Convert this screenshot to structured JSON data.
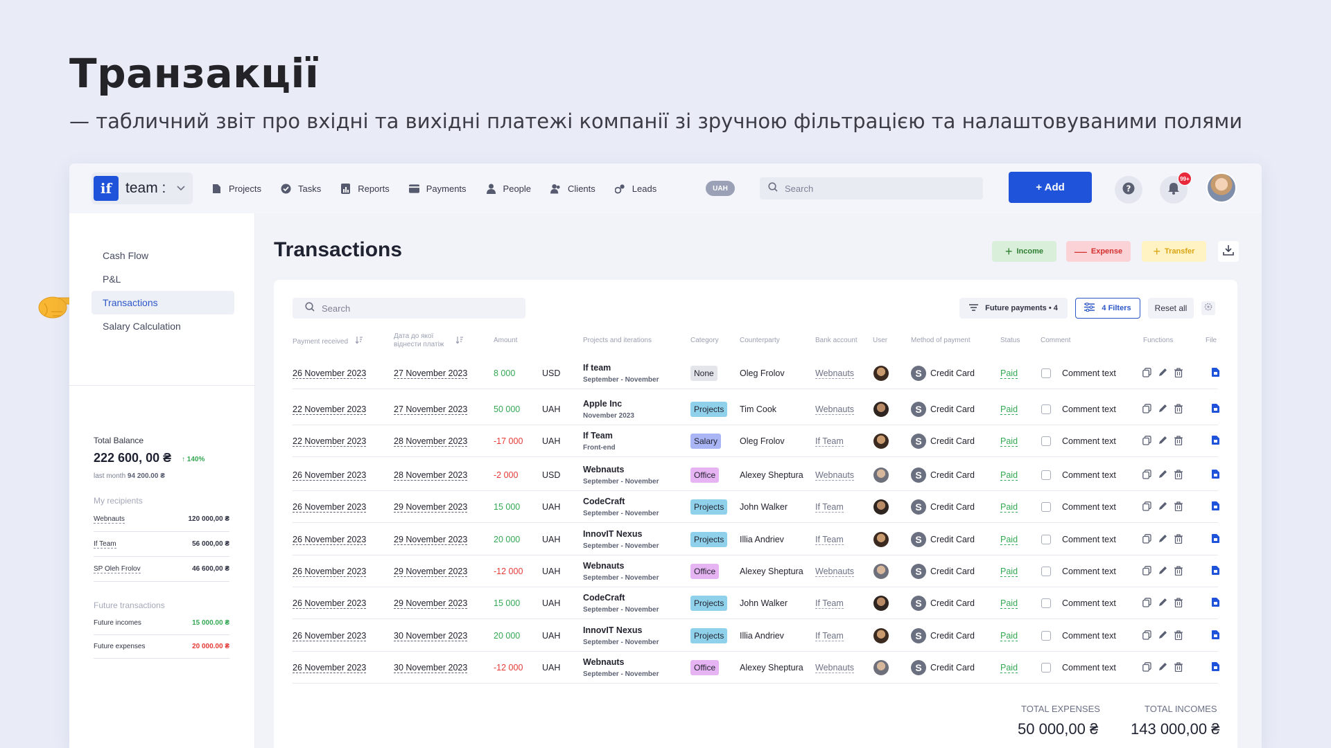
{
  "slide": {
    "title": "Транзакції",
    "subtitle": "— табличний звіт про вхідні та вихідні платежі компанії зі зручною фільтрацією та налаштовуваними полями"
  },
  "brand": {
    "logo": "if",
    "name": "team :"
  },
  "nav": [
    {
      "label": "Projects",
      "icon": "file-icon"
    },
    {
      "label": "Tasks",
      "icon": "check-circle-icon"
    },
    {
      "label": "Reports",
      "icon": "chart-icon"
    },
    {
      "label": "Payments",
      "icon": "card-icon"
    },
    {
      "label": "People",
      "icon": "person-icon"
    },
    {
      "label": "Clients",
      "icon": "people-icon"
    },
    {
      "label": "Leads",
      "icon": "leads-icon"
    }
  ],
  "currency_pill": "UAH",
  "top_search": {
    "placeholder": "Search"
  },
  "add_button": "+ Add",
  "notifications_badge": "99+",
  "sidebar": {
    "menu": [
      "Cash Flow",
      "P&L",
      "Transactions",
      "Salary Calculation"
    ],
    "active": "Transactions",
    "total_balance_label": "Total Balance",
    "total_balance_value": "222 600, 00 ₴",
    "total_balance_delta": "↑ 140%",
    "last_month_label": "last month",
    "last_month_value": "94 200.00 ₴",
    "recipients_title": "My recipients",
    "recipients": [
      {
        "name": "Webnauts",
        "value": "120 000,00 ₴"
      },
      {
        "name": "If Team",
        "value": "56 000,00 ₴"
      },
      {
        "name": "SP Oleh Frolov",
        "value": "46 600,00 ₴"
      }
    ],
    "future_title": "Future transactions",
    "future": [
      {
        "name": "Future incomes",
        "value": "15 000.00 ₴"
      },
      {
        "name": "Future expenses",
        "value": "20 000.00 ₴"
      }
    ]
  },
  "main": {
    "title": "Transactions",
    "income": "Income",
    "expense": "Expense",
    "transfer": "Transfer",
    "search_placeholder": "Search",
    "future_payments": "Future payments • 4",
    "filters": "4 Filters",
    "reset": "Reset all"
  },
  "columns": {
    "payment_received": "Payment received",
    "date_attr": "Дата до якої віднести платіж",
    "amount": "Amount",
    "projects": "Projects and iterations",
    "category": "Category",
    "counterparty": "Counterparty",
    "bank": "Bank account",
    "user": "User",
    "method": "Method  of payment",
    "status": "Status",
    "comment": "Comment",
    "functions": "Functions",
    "file": "File"
  },
  "rows": [
    {
      "received": "26 November 2023",
      "attr": "27 November 2023",
      "amount": "8 000",
      "sign": "pos",
      "cur": "USD",
      "project": "If team",
      "iteration": "September - November",
      "category": "None",
      "cat_color": "#e4e5ea",
      "counterparty": "Oleg Frolov",
      "bank": "Webnauts",
      "method": "Credit Card",
      "status": "Paid",
      "comment": "Comment text"
    },
    {
      "received": "22 November 2023",
      "attr": "27 November 2023",
      "amount": "50 000",
      "sign": "pos",
      "cur": "UAH",
      "project": "Apple Inc",
      "iteration": "November 2023",
      "category": "Projects",
      "cat_color": "#8fd1ea",
      "counterparty": "Tim Cook",
      "bank": "Webnauts",
      "method": "Credit Card",
      "status": "Paid",
      "comment": "Comment text"
    },
    {
      "received": "22 November 2023",
      "attr": "28 November 2023",
      "amount": "-17 000",
      "sign": "neg",
      "cur": "UAH",
      "project": "If Team",
      "iteration": "Front-end",
      "category": "Salary",
      "cat_color": "#a9b5f5",
      "counterparty": "Oleg Frolov",
      "bank": "If Team",
      "method": "Credit Card",
      "status": "Paid",
      "comment": "Comment text"
    },
    {
      "received": "26 November 2023",
      "attr": "28 November 2023",
      "amount": "-2 000",
      "sign": "neg",
      "cur": "USD",
      "project": "Webnauts",
      "iteration": "September - November",
      "category": "Office",
      "cat_color": "#e6b4f2",
      "counterparty": "Alexey Sheptura",
      "bank": "Webnauts",
      "method": "Credit Card",
      "status": "Paid",
      "comment": "Comment text"
    },
    {
      "received": "26 November 2023",
      "attr": "29 November 2023",
      "amount": "15 000",
      "sign": "pos",
      "cur": "UAH",
      "project": "CodeCraft",
      "iteration": "September - November",
      "category": "Projects",
      "cat_color": "#8fd1ea",
      "counterparty": "John Walker",
      "bank": "If Team",
      "method": "Credit Card",
      "status": "Paid",
      "comment": "Comment text"
    },
    {
      "received": "26 November 2023",
      "attr": "29 November 2023",
      "amount": "20 000",
      "sign": "pos",
      "cur": "UAH",
      "project": "InnovIT Nexus",
      "iteration": "September - November",
      "category": "Projects",
      "cat_color": "#8fd1ea",
      "counterparty": "Illia Andriev",
      "bank": "If Team",
      "method": "Credit Card",
      "status": "Paid",
      "comment": "Comment text"
    },
    {
      "received": "26 November 2023",
      "attr": "29 November 2023",
      "amount": "-12 000",
      "sign": "neg",
      "cur": "UAH",
      "project": "Webnauts",
      "iteration": "September - November",
      "category": "Office",
      "cat_color": "#e6b4f2",
      "counterparty": "Alexey Sheptura",
      "bank": "Webnauts",
      "method": "Credit Card",
      "status": "Paid",
      "comment": "Comment text"
    },
    {
      "received": "26 November 2023",
      "attr": "29 November 2023",
      "amount": "15 000",
      "sign": "pos",
      "cur": "UAH",
      "project": "CodeCraft",
      "iteration": "September - November",
      "category": "Projects",
      "cat_color": "#8fd1ea",
      "counterparty": "John Walker",
      "bank": "If Team",
      "method": "Credit Card",
      "status": "Paid",
      "comment": "Comment text"
    },
    {
      "received": "26 November 2023",
      "attr": "30 November 2023",
      "amount": "20 000",
      "sign": "pos",
      "cur": "UAH",
      "project": "InnovIT Nexus",
      "iteration": "September - November",
      "category": "Projects",
      "cat_color": "#8fd1ea",
      "counterparty": "Illia Andriev",
      "bank": "If Team",
      "method": "Credit Card",
      "status": "Paid",
      "comment": "Comment text"
    },
    {
      "received": "26 November 2023",
      "attr": "30 November 2023",
      "amount": "-12 000",
      "sign": "neg",
      "cur": "UAH",
      "project": "Webnauts",
      "iteration": "September - November",
      "category": "Office",
      "cat_color": "#e6b4f2",
      "counterparty": "Alexey Sheptura",
      "bank": "Webnauts",
      "method": "Credit Card",
      "status": "Paid",
      "comment": "Comment text"
    }
  ],
  "totals": {
    "expenses_label": "TOTAL EXPENSES",
    "expenses_value": "50 000,00 ₴",
    "incomes_label": "TOTAL INCOMES",
    "incomes_value": "143 000,00 ₴"
  },
  "colors": {
    "accent": "#1f53d9",
    "positive": "#33a853",
    "negative": "#e53935"
  }
}
